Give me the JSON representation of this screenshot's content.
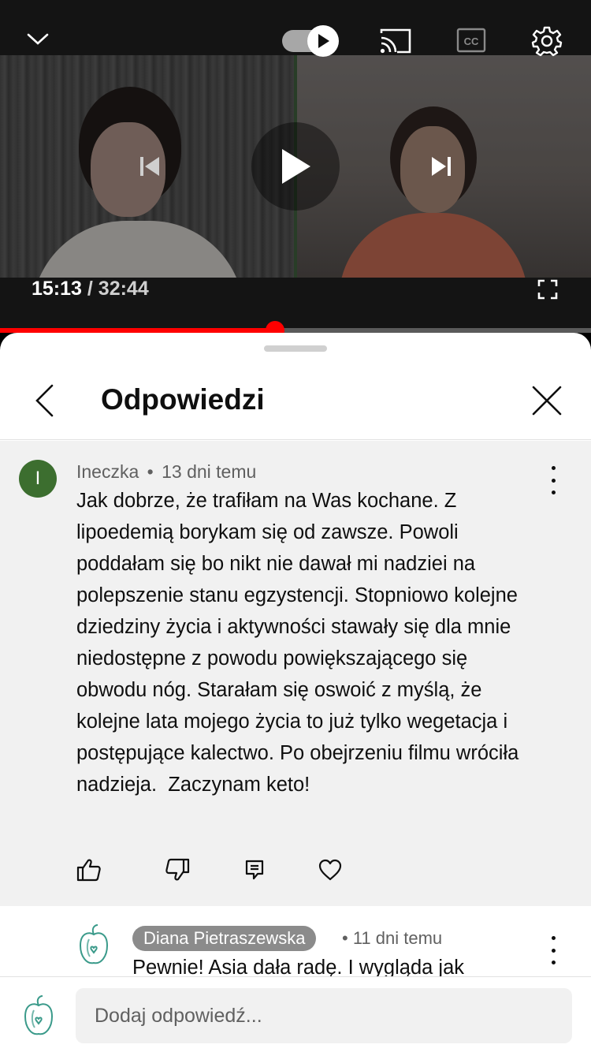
{
  "player": {
    "current_time": "15:13",
    "separator": " / ",
    "duration": "32:44",
    "progress_fraction": 0.465,
    "autoplay_on": true,
    "accent_color": "#ff0000"
  },
  "icons": {
    "collapse": "chevron-down-icon",
    "autoplay": "autoplay-toggle",
    "cast": "cast-icon",
    "captions": "cc-icon",
    "settings": "gear-icon",
    "previous": "previous-icon",
    "play": "play-icon",
    "next": "next-icon",
    "fullscreen": "fullscreen-icon"
  },
  "panel": {
    "title": "Odpowiedzi"
  },
  "comment": {
    "avatar_letter": "I",
    "avatar_color": "#3c6e2f",
    "author": "Ineczka",
    "meta_separator": "•",
    "time_ago": "13 dni temu",
    "text": "Jak dobrze, że trafiłam na Was kochane. Z lipoedemią borykam się od zawsze. Powoli poddałam się bo nikt nie dawał mi nadziei na polepszenie stanu egzystencji. Stopniowo kolejne  dziedziny życia i aktywności stawały się dla mnie niedostępne z powodu powiększającego się obwodu nóg. Starałam się oswoić z myślą, że kolejne lata mojego życia to już tylko wegetacja i postępujące kalectwo. Po obejrzeniu filmu wróciła nadzieja.  Zaczynam keto!"
  },
  "reply": {
    "author": "Diana Pietraszewska",
    "meta_separator": "•",
    "time_ago": "11 dni temu",
    "text": "Pewnie! Asia dała radę. I wygląda jak"
  },
  "composer": {
    "placeholder": "Dodaj odpowiedź..."
  }
}
